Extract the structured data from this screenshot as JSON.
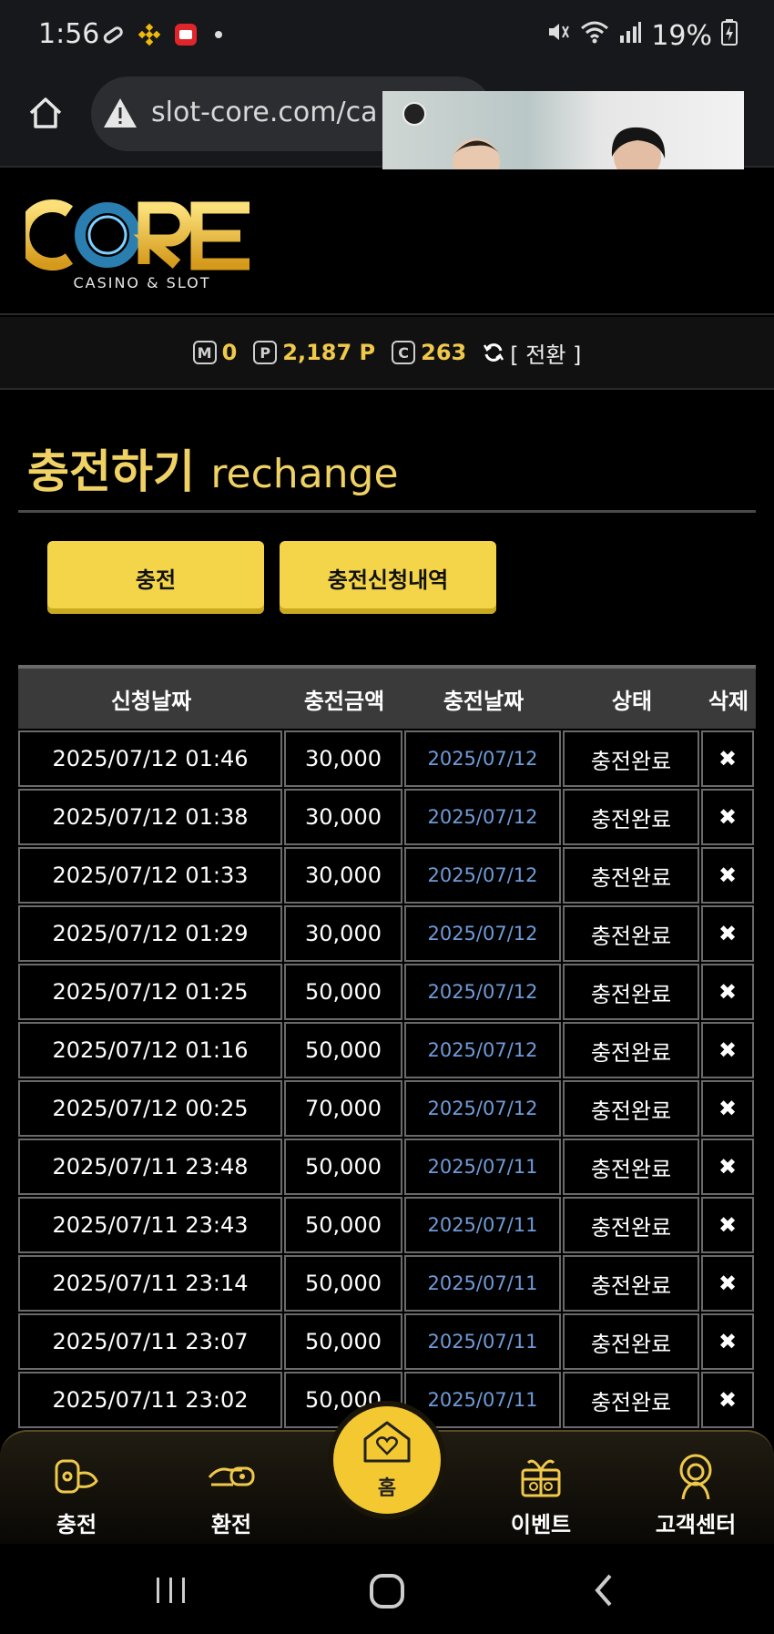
{
  "status_bar": {
    "time": "1:56",
    "battery": "19%"
  },
  "browser": {
    "url": "slot-core.com/cas"
  },
  "site": {
    "logo_text": "CORE",
    "logo_sub": "CASINO & SLOT"
  },
  "balance": {
    "m_label": "M",
    "m_value": "0",
    "p_label": "P",
    "p_value": "2,187 P",
    "c_label": "C",
    "c_value": "263",
    "switch_label": "[ 전환 ]"
  },
  "page": {
    "title_ko": "충전하기",
    "title_en": "rechange"
  },
  "tabs": {
    "charge": "충전",
    "history": "충전신청내역"
  },
  "table": {
    "headers": [
      "신청날짜",
      "충전금액",
      "충전날짜",
      "상태",
      "삭제"
    ],
    "rows": [
      {
        "requested": "2025/07/12 01:46",
        "amount": "30,000",
        "charged": "2025/07/12",
        "status": "충전완료"
      },
      {
        "requested": "2025/07/12 01:38",
        "amount": "30,000",
        "charged": "2025/07/12",
        "status": "충전완료"
      },
      {
        "requested": "2025/07/12 01:33",
        "amount": "30,000",
        "charged": "2025/07/12",
        "status": "충전완료"
      },
      {
        "requested": "2025/07/12 01:29",
        "amount": "30,000",
        "charged": "2025/07/12",
        "status": "충전완료"
      },
      {
        "requested": "2025/07/12 01:25",
        "amount": "50,000",
        "charged": "2025/07/12",
        "status": "충전완료"
      },
      {
        "requested": "2025/07/12 01:16",
        "amount": "50,000",
        "charged": "2025/07/12",
        "status": "충전완료"
      },
      {
        "requested": "2025/07/12 00:25",
        "amount": "70,000",
        "charged": "2025/07/12",
        "status": "충전완료"
      },
      {
        "requested": "2025/07/11 23:48",
        "amount": "50,000",
        "charged": "2025/07/11",
        "status": "충전완료"
      },
      {
        "requested": "2025/07/11 23:43",
        "amount": "50,000",
        "charged": "2025/07/11",
        "status": "충전완료"
      },
      {
        "requested": "2025/07/11 23:14",
        "amount": "50,000",
        "charged": "2025/07/11",
        "status": "충전완료"
      },
      {
        "requested": "2025/07/11 23:07",
        "amount": "50,000",
        "charged": "2025/07/11",
        "status": "충전완료"
      },
      {
        "requested": "2025/07/11 23:02",
        "amount": "50,000",
        "charged": "2025/07/11",
        "status": "충전완료"
      }
    ],
    "delete_glyph": "✖"
  },
  "bottom_nav": {
    "charge": "충전",
    "exchange": "환전",
    "home": "홈",
    "event": "이벤트",
    "support": "고객센터"
  },
  "colors": {
    "accent_gold": "#f4d54a",
    "link_blue": "#6f9bd8",
    "background": "#000000"
  }
}
